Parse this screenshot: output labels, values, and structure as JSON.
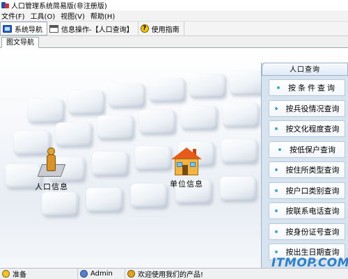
{
  "window": {
    "title": "人口管理系统简易版(非注册版)"
  },
  "menu": {
    "items": [
      "文件(F)",
      "工具(O)",
      "视图(V)",
      "帮助(H)"
    ]
  },
  "toolbar": {
    "nav_label": "系统导航",
    "info_label": "信息操作-【人口查询】",
    "guide_label": "使用指南"
  },
  "tab": {
    "label": "图文导航"
  },
  "desktop": {
    "population_label": "人口信息",
    "unit_label": "单位信息"
  },
  "panel": {
    "title": "人口查询",
    "items": [
      "按条件查询",
      "按兵役情况查询",
      "按文化程度查询",
      "按低保户查询",
      "按住所类型查询",
      "按户口类别查询",
      "按联系电话查询",
      "按身份证号查询",
      "按出生日期查询"
    ]
  },
  "watermark": "ITMOP.COM",
  "status": {
    "ready": "准备",
    "user": "Admin",
    "welcome": "欢迎使用我们的产品!"
  }
}
